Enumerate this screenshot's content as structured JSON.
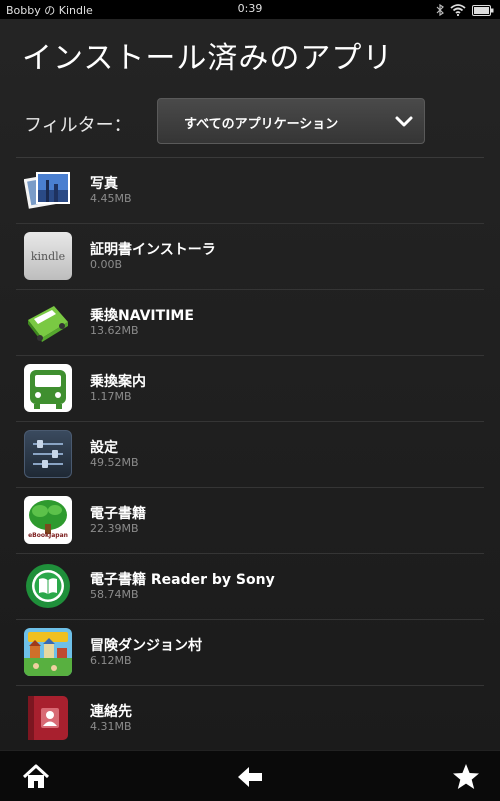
{
  "status_bar": {
    "device_name": "Bobby の Kindle",
    "time": "0:39",
    "icons": [
      "bluetooth-icon",
      "wifi-icon",
      "battery-icon"
    ]
  },
  "page": {
    "title": "インストール済みのアプリ"
  },
  "filter": {
    "label": "フィルター：",
    "selected": "すべてのアプリケーション"
  },
  "apps": [
    {
      "name": "写真",
      "size": "4.45MB",
      "icon": "photos-icon"
    },
    {
      "name": "証明書インストーラ",
      "size": "0.00B",
      "icon": "kindle-icon",
      "icon_text": "kindle"
    },
    {
      "name": "乗換NAVITIME",
      "size": "13.62MB",
      "icon": "navitime-bus-icon"
    },
    {
      "name": "乗換案内",
      "size": "1.17MB",
      "icon": "train-icon"
    },
    {
      "name": "設定",
      "size": "49.52MB",
      "icon": "settings-sliders-icon"
    },
    {
      "name": "電子書籍",
      "size": "22.39MB",
      "icon": "ebook-tree-icon",
      "icon_text": "eBookJapan"
    },
    {
      "name": "電子書籍 Reader by Sony",
      "size": "58.74MB",
      "icon": "sony-reader-book-icon"
    },
    {
      "name": "冒険ダンジョン村",
      "size": "6.12MB",
      "icon": "dungeon-village-icon"
    },
    {
      "name": "連絡先",
      "size": "4.31MB",
      "icon": "contacts-icon"
    }
  ],
  "nav": {
    "buttons": [
      "home-icon",
      "back-arrow-icon",
      "favorites-star-icon"
    ]
  },
  "colors": {
    "background": "#1c1c1c",
    "status_bar": "#000000",
    "nav_bar": "#0a0a0a",
    "secondary_text": "#8c8c8c",
    "divider": "#353535"
  }
}
